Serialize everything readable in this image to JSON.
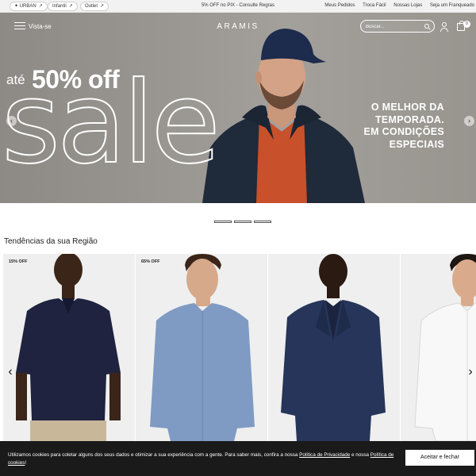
{
  "topbar": {
    "pills": [
      {
        "label": "URBAN",
        "arrow": "↗"
      },
      {
        "label": "Infantil",
        "arrow": "↗"
      },
      {
        "label": "Outlet",
        "arrow": "↗"
      }
    ],
    "promo": "5% OFF no PIX - Consulte Regras",
    "links": [
      "Meus Pedidos",
      "Troca Fácil",
      "Nossas Lojas",
      "Seja um Franqueado"
    ]
  },
  "header": {
    "menu_label": "Vista-se",
    "logo": "ARAMIS",
    "search_placeholder": "Buscar...",
    "cart_count": "0"
  },
  "hero": {
    "prefix": "até",
    "discount": "50% off",
    "headline": "sale",
    "tagline": [
      "O MELHOR DA",
      "TEMPORADA.",
      "EM CONDIÇÕES",
      "ESPECIAIS"
    ],
    "prev": "‹",
    "next": "›"
  },
  "section": {
    "title": "Tendências da sua Região"
  },
  "products": [
    {
      "badge": "15% OFF",
      "item": "polo-shirt",
      "color": "#1f2340"
    },
    {
      "badge": "65% OFF",
      "item": "dress-shirt",
      "color": "#7f9bc4"
    },
    {
      "badge": "",
      "item": "suit",
      "color": "#263559"
    },
    {
      "badge": "",
      "item": "white-shirt",
      "color": "#f4f4f4"
    }
  ],
  "product_nav": {
    "prev": "‹",
    "next": "›"
  },
  "cookie": {
    "text_1": "Utilizamos cookies para coletar alguns dos seus dados e otimizar a sua experiência com a gente. Para saber mais, confira a nossa ",
    "link_1": "Política de Privacidade",
    "text_2": " e nossa ",
    "link_2": "Política de cookies",
    "text_3": "!",
    "button": "Aceitar e fechar"
  },
  "colors": {
    "cookie_bg": "#1a1a1a",
    "hero_bg": "#9b9893",
    "jacket": "#1f2a3a",
    "sweater": "#c8502a"
  }
}
